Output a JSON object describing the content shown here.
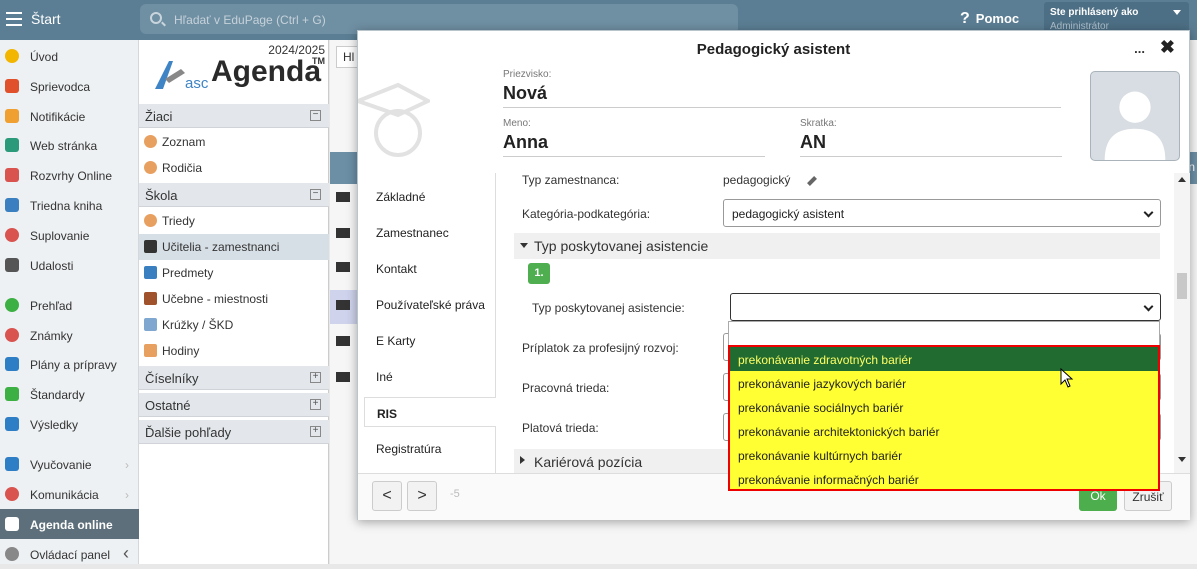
{
  "topbar": {
    "start_label": "Štart",
    "search_placeholder": "Hľadať v EduPage (Ctrl + G)",
    "help_label": "Pomoc",
    "user_line1": "Ste prihlásený ako",
    "user_line2": "Administrátor"
  },
  "sidebar": {
    "items": [
      {
        "label": "Úvod",
        "color": "#f2b500"
      },
      {
        "label": "Sprievodca",
        "color": "#e0502a"
      },
      {
        "label": "Notifikácie",
        "color": "#f0a030"
      },
      {
        "label": "Web stránka",
        "color": "#2a9a7a"
      },
      {
        "label": "Rozvrhy Online",
        "color": "#d9534f"
      },
      {
        "label": "Triedna kniha",
        "color": "#3a7fc0"
      },
      {
        "label": "Suplovanie",
        "color": "#d9534f"
      },
      {
        "label": "Udalosti",
        "color": "#555555"
      },
      {
        "label": "Prehľad",
        "color": "#3cb043"
      },
      {
        "label": "Známky",
        "color": "#d9534f"
      },
      {
        "label": "Plány a prípravy",
        "color": "#2d7ec4"
      },
      {
        "label": "Štandardy",
        "color": "#3cb043"
      },
      {
        "label": "Výsledky",
        "color": "#2d7ec4"
      },
      {
        "label": "Vyučovanie",
        "color": "#2d7ec4"
      },
      {
        "label": "Komunikácia",
        "color": "#d9534f"
      },
      {
        "label": "Agenda online",
        "color": "#ffffff"
      },
      {
        "label": "Ovládací panel",
        "color": "#888888"
      }
    ]
  },
  "panel": {
    "year": "2024/2025",
    "logo_asc": "asc",
    "logo_agenda": "Agenda",
    "logo_tm": "TM",
    "sections": [
      {
        "label": "Žiaci",
        "toggle": "−"
      },
      {
        "label": "Škola",
        "toggle": "−"
      },
      {
        "label": "Číselníky",
        "toggle": "+"
      },
      {
        "label": "Ostatné",
        "toggle": "+"
      },
      {
        "label": "Ďalšie pohľady",
        "toggle": "+"
      }
    ],
    "items": [
      {
        "label": "Zoznam"
      },
      {
        "label": "Rodičia"
      },
      {
        "label": "Triedy"
      },
      {
        "label": "Učitelia - zamestnanci"
      },
      {
        "label": "Predmety"
      },
      {
        "label": "Učebne - miestnosti"
      },
      {
        "label": "Krúžky / ŠKD"
      },
      {
        "label": "Hodiny"
      }
    ]
  },
  "background": {
    "tab_label": "Hl",
    "header_fragment": "n"
  },
  "dialog": {
    "title": "Pedagogický asistent",
    "more": "...",
    "close": "✖",
    "surname_label": "Priezvisko:",
    "surname": "Nová",
    "name_label": "Meno:",
    "name": "Anna",
    "abbr_label": "Skratka:",
    "abbr": "AN",
    "tabs": [
      "Základné",
      "Zamestnanec",
      "Kontakt",
      "Používateľské práva",
      "E Karty",
      "Iné",
      "RIS",
      "Registratúra"
    ],
    "fields": {
      "employee_type_label": "Typ zamestnanca:",
      "employee_type_value": "pedagogický",
      "category_label": "Kategória-podkategória:",
      "category_value": "pedagogický asistent",
      "group_header": "Typ poskytovanej asistencie",
      "step": "1.",
      "assist_type_label": "Typ poskytovanej asistencie:",
      "allowance_label": "Príplatok za profesijný rozvoj:",
      "work_class_label": "Pracovná trieda:",
      "pay_class_label": "Platová trieda:",
      "career_header": "Kariérová pozícia"
    },
    "footer": {
      "prev": "<",
      "next": ">",
      "count": "-5",
      "ok": "Ok",
      "cancel": "Zrušiť"
    }
  },
  "dropdown": {
    "options": [
      "prekonávanie zdravotných bariér",
      "prekonávanie jazykových bariér",
      "prekonávanie sociálnych bariér",
      "prekonávanie architektonických bariér",
      "prekonávanie kultúrnych bariér",
      "prekonávanie informačných bariér"
    ],
    "highlighted_index": 0
  }
}
